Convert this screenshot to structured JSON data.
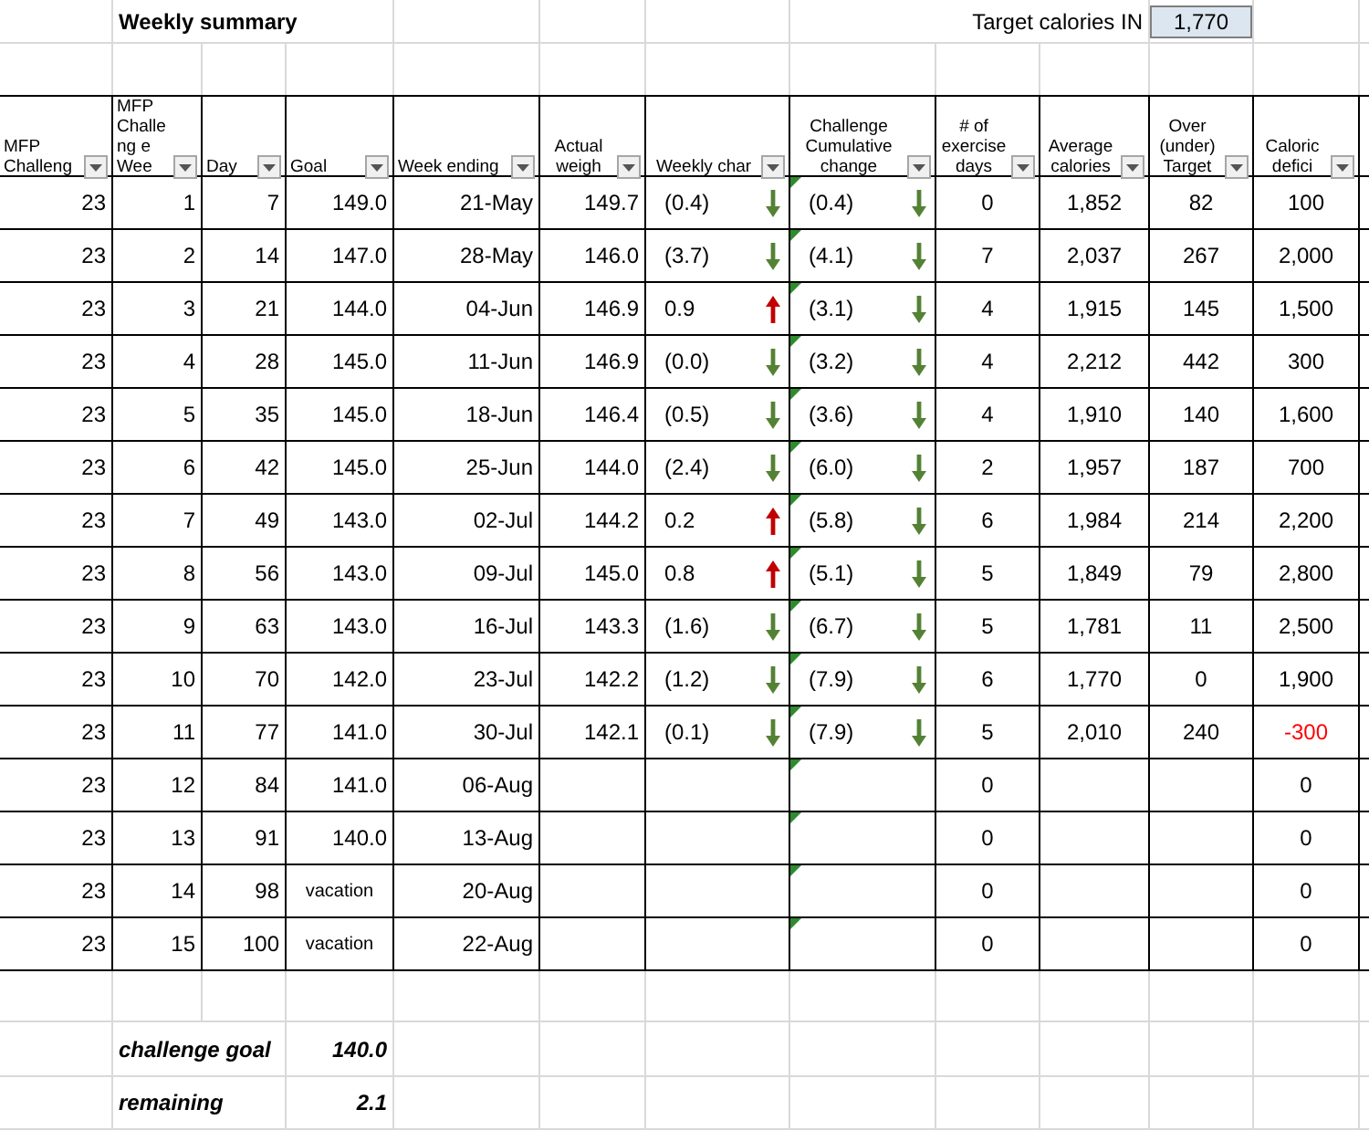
{
  "title": "Weekly summary",
  "target": {
    "label": "Target calories IN",
    "value": "1,770"
  },
  "columns": [
    "MFP Challeng",
    "MFP Challeng e Wee",
    "Day",
    "Goal",
    "Week ending",
    "Actual weigh",
    "Weekly char",
    "Challenge Cumulative change",
    "# of exercise days",
    "Average calories",
    "Over (under) Target",
    "Caloric defici"
  ],
  "rows": [
    {
      "mfp": "23",
      "week": "1",
      "day": "7",
      "goal": "149.0",
      "goal_note": false,
      "week_ending": "21-May",
      "actual": "149.7",
      "weekly_change": "(0.4)",
      "weekly_up": false,
      "cumulative": "(0.4)",
      "cumulative_up": false,
      "exercise_days": "0",
      "avg_calories": "1,852",
      "over_under": "82",
      "deficit": "100",
      "deficit_alert": false
    },
    {
      "mfp": "23",
      "week": "2",
      "day": "14",
      "goal": "147.0",
      "goal_note": false,
      "week_ending": "28-May",
      "actual": "146.0",
      "weekly_change": "(3.7)",
      "weekly_up": false,
      "cumulative": "(4.1)",
      "cumulative_up": false,
      "exercise_days": "7",
      "avg_calories": "2,037",
      "over_under": "267",
      "deficit": "2,000",
      "deficit_alert": false
    },
    {
      "mfp": "23",
      "week": "3",
      "day": "21",
      "goal": "144.0",
      "goal_note": false,
      "week_ending": "04-Jun",
      "actual": "146.9",
      "weekly_change": "0.9",
      "weekly_up": true,
      "cumulative": "(3.1)",
      "cumulative_up": false,
      "exercise_days": "4",
      "avg_calories": "1,915",
      "over_under": "145",
      "deficit": "1,500",
      "deficit_alert": false
    },
    {
      "mfp": "23",
      "week": "4",
      "day": "28",
      "goal": "145.0",
      "goal_note": false,
      "week_ending": "11-Jun",
      "actual": "146.9",
      "weekly_change": "(0.0)",
      "weekly_up": false,
      "cumulative": "(3.2)",
      "cumulative_up": false,
      "exercise_days": "4",
      "avg_calories": "2,212",
      "over_under": "442",
      "deficit": "300",
      "deficit_alert": false
    },
    {
      "mfp": "23",
      "week": "5",
      "day": "35",
      "goal": "145.0",
      "goal_note": false,
      "week_ending": "18-Jun",
      "actual": "146.4",
      "weekly_change": "(0.5)",
      "weekly_up": false,
      "cumulative": "(3.6)",
      "cumulative_up": false,
      "exercise_days": "4",
      "avg_calories": "1,910",
      "over_under": "140",
      "deficit": "1,600",
      "deficit_alert": false
    },
    {
      "mfp": "23",
      "week": "6",
      "day": "42",
      "goal": "145.0",
      "goal_note": false,
      "week_ending": "25-Jun",
      "actual": "144.0",
      "weekly_change": "(2.4)",
      "weekly_up": false,
      "cumulative": "(6.0)",
      "cumulative_up": false,
      "exercise_days": "2",
      "avg_calories": "1,957",
      "over_under": "187",
      "deficit": "700",
      "deficit_alert": false
    },
    {
      "mfp": "23",
      "week": "7",
      "day": "49",
      "goal": "143.0",
      "goal_note": false,
      "week_ending": "02-Jul",
      "actual": "144.2",
      "weekly_change": "0.2",
      "weekly_up": true,
      "cumulative": "(5.8)",
      "cumulative_up": false,
      "exercise_days": "6",
      "avg_calories": "1,984",
      "over_under": "214",
      "deficit": "2,200",
      "deficit_alert": false
    },
    {
      "mfp": "23",
      "week": "8",
      "day": "56",
      "goal": "143.0",
      "goal_note": false,
      "week_ending": "09-Jul",
      "actual": "145.0",
      "weekly_change": "0.8",
      "weekly_up": true,
      "cumulative": "(5.1)",
      "cumulative_up": false,
      "exercise_days": "5",
      "avg_calories": "1,849",
      "over_under": "79",
      "deficit": "2,800",
      "deficit_alert": false
    },
    {
      "mfp": "23",
      "week": "9",
      "day": "63",
      "goal": "143.0",
      "goal_note": false,
      "week_ending": "16-Jul",
      "actual": "143.3",
      "weekly_change": "(1.6)",
      "weekly_up": false,
      "cumulative": "(6.7)",
      "cumulative_up": false,
      "exercise_days": "5",
      "avg_calories": "1,781",
      "over_under": "11",
      "deficit": "2,500",
      "deficit_alert": false
    },
    {
      "mfp": "23",
      "week": "10",
      "day": "70",
      "goal": "142.0",
      "goal_note": false,
      "week_ending": "23-Jul",
      "actual": "142.2",
      "weekly_change": "(1.2)",
      "weekly_up": false,
      "cumulative": "(7.9)",
      "cumulative_up": false,
      "exercise_days": "6",
      "avg_calories": "1,770",
      "over_under": "0",
      "deficit": "1,900",
      "deficit_alert": false
    },
    {
      "mfp": "23",
      "week": "11",
      "day": "77",
      "goal": "141.0",
      "goal_note": false,
      "week_ending": "30-Jul",
      "actual": "142.1",
      "weekly_change": "(0.1)",
      "weekly_up": false,
      "cumulative": "(7.9)",
      "cumulative_up": false,
      "exercise_days": "5",
      "avg_calories": "2,010",
      "over_under": "240",
      "deficit": "-300",
      "deficit_alert": true
    },
    {
      "mfp": "23",
      "week": "12",
      "day": "84",
      "goal": "141.0",
      "goal_note": false,
      "week_ending": "06-Aug",
      "exercise_days": "0",
      "deficit": "0",
      "deficit_alert": false
    },
    {
      "mfp": "23",
      "week": "13",
      "day": "91",
      "goal": "140.0",
      "goal_note": false,
      "week_ending": "13-Aug",
      "exercise_days": "0",
      "deficit": "0",
      "deficit_alert": false
    },
    {
      "mfp": "23",
      "week": "14",
      "day": "98",
      "goal": "vacation",
      "goal_note": true,
      "week_ending": "20-Aug",
      "exercise_days": "0",
      "deficit": "0",
      "deficit_alert": false
    },
    {
      "mfp": "23",
      "week": "15",
      "day": "100",
      "goal": "vacation",
      "goal_note": true,
      "week_ending": "22-Aug",
      "exercise_days": "0",
      "deficit": "0",
      "deficit_alert": false
    }
  ],
  "summary": [
    {
      "label": "challenge goal",
      "value": "140.0"
    },
    {
      "label": "remaining",
      "value": "2.1"
    }
  ]
}
